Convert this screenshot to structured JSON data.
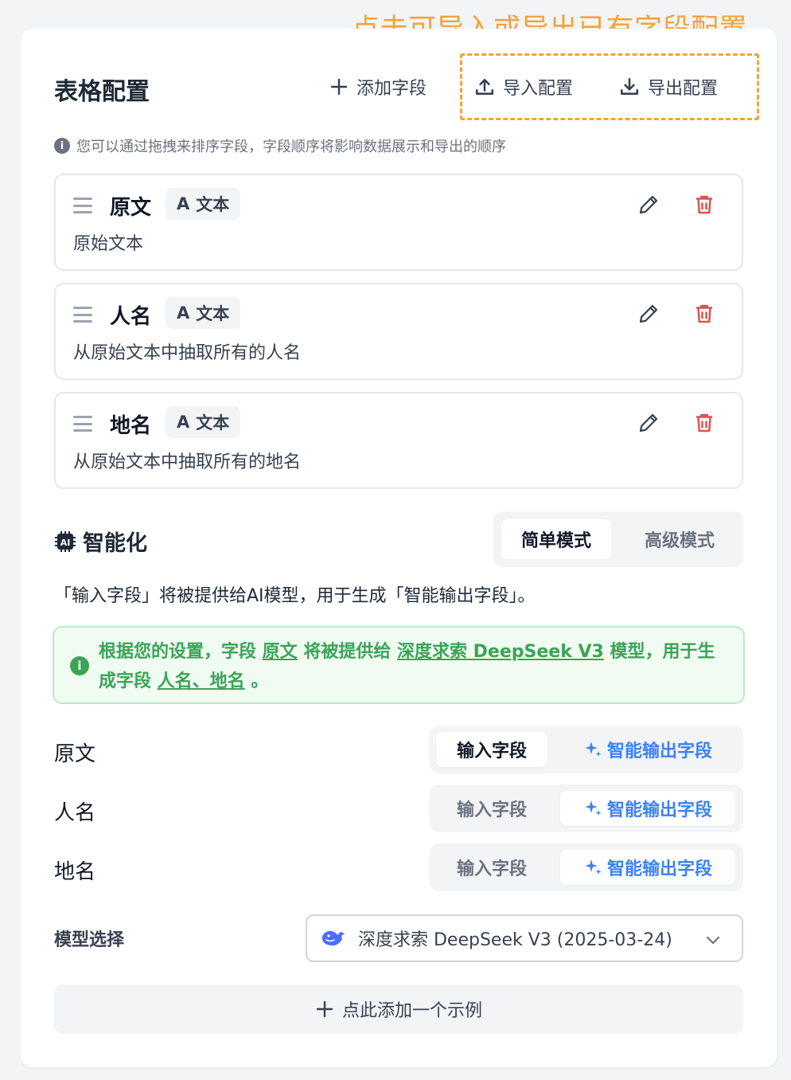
{
  "annotation": "点击可导入或导出已有字段配置",
  "header": {
    "title": "表格配置",
    "add_field": "添加字段",
    "import": "导入配置",
    "export": "导出配置"
  },
  "hint": "您可以通过拖拽来排序字段，字段顺序将影响数据展示和导出的顺序",
  "fields": [
    {
      "name": "原文",
      "type": "文本",
      "desc": "原始文本"
    },
    {
      "name": "人名",
      "type": "文本",
      "desc": "从原始文本中抽取所有的人名"
    },
    {
      "name": "地名",
      "type": "文本",
      "desc": "从原始文本中抽取所有的地名"
    }
  ],
  "ai": {
    "section_title": "智能化",
    "mode_simple": "简单模式",
    "mode_advanced": "高级模式",
    "description": "「输入字段」将被提供给AI模型，用于生成「智能输出字段」。",
    "notice": {
      "p1": "根据您的设置，字段 ",
      "input_fields": "原文",
      "p2": " 将被提供给 ",
      "model": "深度求索 DeepSeek V3",
      "p3": " 模型，用于生成字段 ",
      "output_fields": "人名、地名",
      "p4": " 。"
    },
    "rows": [
      {
        "label": "原文",
        "input": "输入字段",
        "output": "智能输出字段",
        "selected": "input"
      },
      {
        "label": "人名",
        "input": "输入字段",
        "output": "智能输出字段",
        "selected": "output"
      },
      {
        "label": "地名",
        "input": "输入字段",
        "output": "智能输出字段",
        "selected": "output"
      }
    ],
    "model_label": "模型选择",
    "model_value": "深度求索 DeepSeek V3 (2025-03-24)",
    "add_example": "点此添加一个示例"
  },
  "colors": {
    "annotation": "#f2a33a",
    "accent_blue": "#3b82f6",
    "success_green": "#3aa457",
    "danger_red": "#e05252"
  }
}
